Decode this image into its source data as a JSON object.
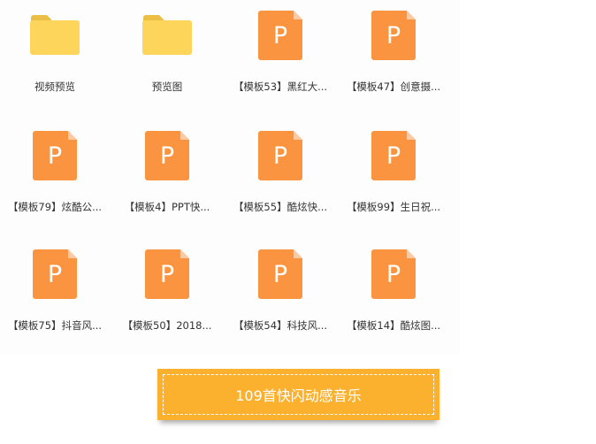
{
  "files": [
    {
      "name": "视频预览",
      "type": "folder"
    },
    {
      "name": "预览图",
      "type": "folder"
    },
    {
      "name": "【模板53】黑红大...",
      "type": "ppt"
    },
    {
      "name": "【模板47】创意摄...",
      "type": "ppt"
    },
    {
      "name": "【模板79】炫酷公...",
      "type": "ppt"
    },
    {
      "name": "【模板4】PPT快...",
      "type": "ppt"
    },
    {
      "name": "【模板55】酷炫快...",
      "type": "ppt"
    },
    {
      "name": "【模板99】生日祝...",
      "type": "ppt"
    },
    {
      "name": "【模板75】抖音风...",
      "type": "ppt"
    },
    {
      "name": "【模板50】2018...",
      "type": "ppt"
    },
    {
      "name": "【模板54】科技风...",
      "type": "ppt"
    },
    {
      "name": "【模板14】酷炫图...",
      "type": "ppt"
    }
  ],
  "ppt_letter": "P",
  "button": {
    "label": "109首快闪动感音乐"
  },
  "colors": {
    "folder": "#fdd55a",
    "ppt": "#fb9440",
    "button": "#fbb12e"
  }
}
